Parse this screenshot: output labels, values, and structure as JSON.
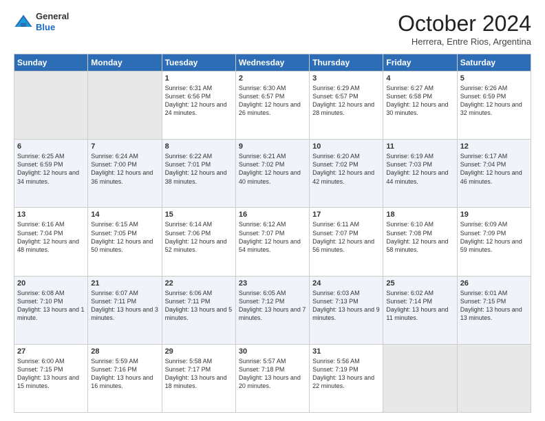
{
  "logo": {
    "general": "General",
    "blue": "Blue"
  },
  "header": {
    "month": "October 2024",
    "location": "Herrera, Entre Rios, Argentina"
  },
  "weekdays": [
    "Sunday",
    "Monday",
    "Tuesday",
    "Wednesday",
    "Thursday",
    "Friday",
    "Saturday"
  ],
  "weeks": [
    [
      {
        "day": null,
        "content": null
      },
      {
        "day": null,
        "content": null
      },
      {
        "day": "1",
        "content": "Sunrise: 6:31 AM\nSunset: 6:56 PM\nDaylight: 12 hours and 24 minutes."
      },
      {
        "day": "2",
        "content": "Sunrise: 6:30 AM\nSunset: 6:57 PM\nDaylight: 12 hours and 26 minutes."
      },
      {
        "day": "3",
        "content": "Sunrise: 6:29 AM\nSunset: 6:57 PM\nDaylight: 12 hours and 28 minutes."
      },
      {
        "day": "4",
        "content": "Sunrise: 6:27 AM\nSunset: 6:58 PM\nDaylight: 12 hours and 30 minutes."
      },
      {
        "day": "5",
        "content": "Sunrise: 6:26 AM\nSunset: 6:59 PM\nDaylight: 12 hours and 32 minutes."
      }
    ],
    [
      {
        "day": "6",
        "content": "Sunrise: 6:25 AM\nSunset: 6:59 PM\nDaylight: 12 hours and 34 minutes."
      },
      {
        "day": "7",
        "content": "Sunrise: 6:24 AM\nSunset: 7:00 PM\nDaylight: 12 hours and 36 minutes."
      },
      {
        "day": "8",
        "content": "Sunrise: 6:22 AM\nSunset: 7:01 PM\nDaylight: 12 hours and 38 minutes."
      },
      {
        "day": "9",
        "content": "Sunrise: 6:21 AM\nSunset: 7:02 PM\nDaylight: 12 hours and 40 minutes."
      },
      {
        "day": "10",
        "content": "Sunrise: 6:20 AM\nSunset: 7:02 PM\nDaylight: 12 hours and 42 minutes."
      },
      {
        "day": "11",
        "content": "Sunrise: 6:19 AM\nSunset: 7:03 PM\nDaylight: 12 hours and 44 minutes."
      },
      {
        "day": "12",
        "content": "Sunrise: 6:17 AM\nSunset: 7:04 PM\nDaylight: 12 hours and 46 minutes."
      }
    ],
    [
      {
        "day": "13",
        "content": "Sunrise: 6:16 AM\nSunset: 7:04 PM\nDaylight: 12 hours and 48 minutes."
      },
      {
        "day": "14",
        "content": "Sunrise: 6:15 AM\nSunset: 7:05 PM\nDaylight: 12 hours and 50 minutes."
      },
      {
        "day": "15",
        "content": "Sunrise: 6:14 AM\nSunset: 7:06 PM\nDaylight: 12 hours and 52 minutes."
      },
      {
        "day": "16",
        "content": "Sunrise: 6:12 AM\nSunset: 7:07 PM\nDaylight: 12 hours and 54 minutes."
      },
      {
        "day": "17",
        "content": "Sunrise: 6:11 AM\nSunset: 7:07 PM\nDaylight: 12 hours and 56 minutes."
      },
      {
        "day": "18",
        "content": "Sunrise: 6:10 AM\nSunset: 7:08 PM\nDaylight: 12 hours and 58 minutes."
      },
      {
        "day": "19",
        "content": "Sunrise: 6:09 AM\nSunset: 7:09 PM\nDaylight: 12 hours and 59 minutes."
      }
    ],
    [
      {
        "day": "20",
        "content": "Sunrise: 6:08 AM\nSunset: 7:10 PM\nDaylight: 13 hours and 1 minute."
      },
      {
        "day": "21",
        "content": "Sunrise: 6:07 AM\nSunset: 7:11 PM\nDaylight: 13 hours and 3 minutes."
      },
      {
        "day": "22",
        "content": "Sunrise: 6:06 AM\nSunset: 7:11 PM\nDaylight: 13 hours and 5 minutes."
      },
      {
        "day": "23",
        "content": "Sunrise: 6:05 AM\nSunset: 7:12 PM\nDaylight: 13 hours and 7 minutes."
      },
      {
        "day": "24",
        "content": "Sunrise: 6:03 AM\nSunset: 7:13 PM\nDaylight: 13 hours and 9 minutes."
      },
      {
        "day": "25",
        "content": "Sunrise: 6:02 AM\nSunset: 7:14 PM\nDaylight: 13 hours and 11 minutes."
      },
      {
        "day": "26",
        "content": "Sunrise: 6:01 AM\nSunset: 7:15 PM\nDaylight: 13 hours and 13 minutes."
      }
    ],
    [
      {
        "day": "27",
        "content": "Sunrise: 6:00 AM\nSunset: 7:15 PM\nDaylight: 13 hours and 15 minutes."
      },
      {
        "day": "28",
        "content": "Sunrise: 5:59 AM\nSunset: 7:16 PM\nDaylight: 13 hours and 16 minutes."
      },
      {
        "day": "29",
        "content": "Sunrise: 5:58 AM\nSunset: 7:17 PM\nDaylight: 13 hours and 18 minutes."
      },
      {
        "day": "30",
        "content": "Sunrise: 5:57 AM\nSunset: 7:18 PM\nDaylight: 13 hours and 20 minutes."
      },
      {
        "day": "31",
        "content": "Sunrise: 5:56 AM\nSunset: 7:19 PM\nDaylight: 13 hours and 22 minutes."
      },
      {
        "day": null,
        "content": null
      },
      {
        "day": null,
        "content": null
      }
    ]
  ]
}
